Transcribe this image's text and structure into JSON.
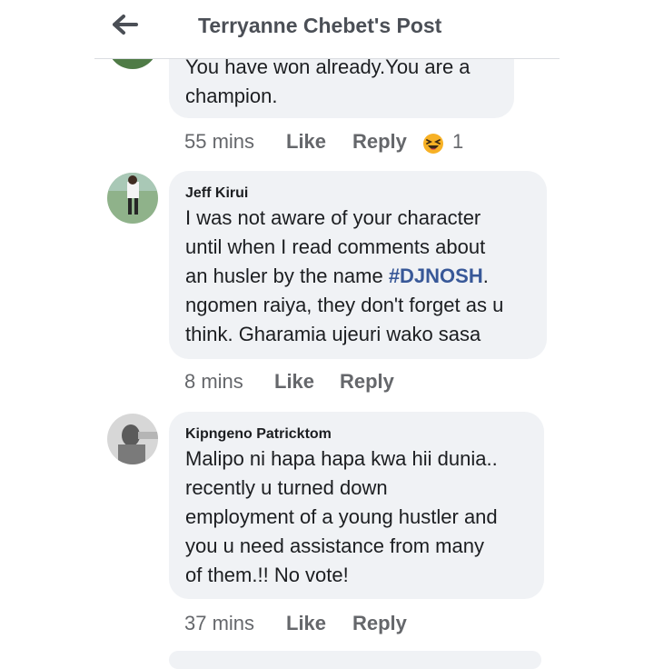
{
  "header": {
    "title": "Terryanne Chebet's Post",
    "back_icon": "arrow-left-icon"
  },
  "comments": [
    {
      "author": "",
      "text_lines": [
        "You have won  already.You are a",
        "champion."
      ],
      "time": "55 mins",
      "like_label": "Like",
      "reply_label": "Reply",
      "reaction_icon": "haha-reaction-icon",
      "reaction_count": "1"
    },
    {
      "author": "Jeff Kirui",
      "text_before": "I was not aware of your character\nuntil when I read comments about\nan husler by the name ",
      "hashtag": "#DJNOSH",
      "text_after": ".\nngomen raiya, they don't forget as u\nthink. Gharamia ujeuri wako sasa",
      "time": "8 mins",
      "like_label": "Like",
      "reply_label": "Reply"
    },
    {
      "author": "Kipngeno Patricktom",
      "text": "Malipo ni hapa hapa kwa hii dunia..\nrecently u turned down\nemployment of a young hustler and\nyou u need assistance from many\nof them.!! No vote!",
      "time": "37 mins",
      "like_label": "Like",
      "reply_label": "Reply"
    }
  ],
  "colors": {
    "bubble": "#f0f2f5",
    "meta": "#65676b",
    "hashtag": "#385898",
    "title": "#4b4f56",
    "haha_face": "#f7b125"
  }
}
